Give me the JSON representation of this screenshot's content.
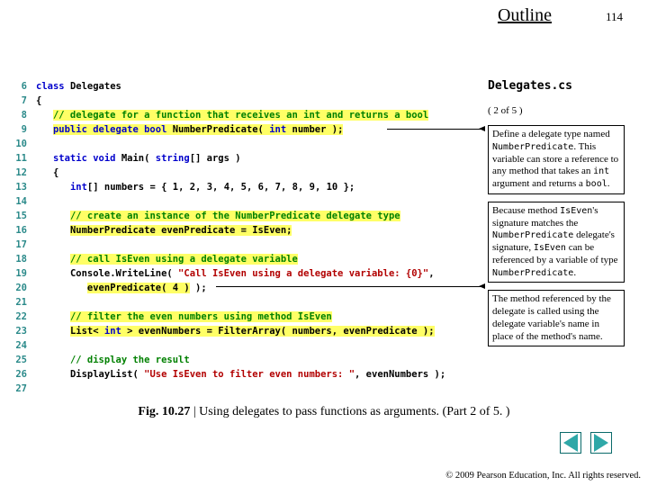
{
  "header": {
    "outline": "Outline",
    "page_number": "114"
  },
  "sidebar": {
    "filename": "Delegates.cs",
    "part": "( 2 of 5 )",
    "callouts": [
      {
        "pre": "Define a delegate type named ",
        "mono1": "NumberPredicate",
        "mid": ". This variable can store a reference to any method that takes an ",
        "mono2": "int",
        "post": " argument and returns a ",
        "mono3": "bool",
        "tail": "."
      },
      {
        "pre": "Because method ",
        "mono1": "IsEven",
        "mid": "'s signature matches the ",
        "mono2": "NumberPredicate",
        "mid2": " delegate's signature, ",
        "mono3": "IsEven",
        "mid3": " can be referenced by a variable of type ",
        "mono4": "NumberPredicate",
        "tail": "."
      },
      {
        "pre": "The method referenced by the delegate is called using the delegate variable's name in place of the method's name.",
        "mono1": "",
        "mid": "",
        "tail": ""
      }
    ]
  },
  "code": [
    {
      "n": "6",
      "seg": [
        [
          "kw",
          "class "
        ],
        [
          "nm",
          "Delegates"
        ]
      ]
    },
    {
      "n": "7",
      "seg": [
        [
          "nm",
          "{"
        ]
      ]
    },
    {
      "n": "8",
      "seg": [
        [
          "sp",
          "   "
        ],
        [
          "hl-cm",
          "// delegate for a function that receives an int and returns a bool"
        ]
      ]
    },
    {
      "n": "9",
      "seg": [
        [
          "sp",
          "   "
        ],
        [
          "hl-kw",
          "public delegate bool"
        ],
        [
          "hl-nm",
          " NumberPredicate( "
        ],
        [
          "hl-kw",
          "int"
        ],
        [
          "hl-nm",
          " number );"
        ]
      ]
    },
    {
      "n": "10",
      "seg": [
        [
          "nm",
          ""
        ]
      ]
    },
    {
      "n": "11",
      "seg": [
        [
          "sp",
          "   "
        ],
        [
          "kw",
          "static void "
        ],
        [
          "nm",
          "Main( "
        ],
        [
          "kw",
          "string"
        ],
        [
          "nm",
          "[] args )"
        ]
      ]
    },
    {
      "n": "12",
      "seg": [
        [
          "sp",
          "   "
        ],
        [
          "nm",
          "{"
        ]
      ]
    },
    {
      "n": "13",
      "seg": [
        [
          "sp",
          "      "
        ],
        [
          "kw",
          "int"
        ],
        [
          "nm",
          "[] numbers = { "
        ],
        [
          "num",
          "1"
        ],
        [
          "nm",
          ", "
        ],
        [
          "num",
          "2"
        ],
        [
          "nm",
          ", "
        ],
        [
          "num",
          "3"
        ],
        [
          "nm",
          ", "
        ],
        [
          "num",
          "4"
        ],
        [
          "nm",
          ", "
        ],
        [
          "num",
          "5"
        ],
        [
          "nm",
          ", "
        ],
        [
          "num",
          "6"
        ],
        [
          "nm",
          ", "
        ],
        [
          "num",
          "7"
        ],
        [
          "nm",
          ", "
        ],
        [
          "num",
          "8"
        ],
        [
          "nm",
          ", "
        ],
        [
          "num",
          "9"
        ],
        [
          "nm",
          ", "
        ],
        [
          "num",
          "10"
        ],
        [
          "nm",
          " };"
        ]
      ]
    },
    {
      "n": "14",
      "seg": [
        [
          "nm",
          ""
        ]
      ]
    },
    {
      "n": "15",
      "seg": [
        [
          "sp",
          "      "
        ],
        [
          "hl-cm",
          "// create an instance of the NumberPredicate delegate type"
        ]
      ]
    },
    {
      "n": "16",
      "seg": [
        [
          "sp",
          "      "
        ],
        [
          "hl-nm",
          "NumberPredicate evenPredicate = IsEven;"
        ]
      ]
    },
    {
      "n": "17",
      "seg": [
        [
          "nm",
          ""
        ]
      ]
    },
    {
      "n": "18",
      "seg": [
        [
          "sp",
          "      "
        ],
        [
          "hl-cm",
          "// call IsEven using a delegate variable"
        ]
      ]
    },
    {
      "n": "19",
      "seg": [
        [
          "sp",
          "      "
        ],
        [
          "nm",
          "Console.WriteLine( "
        ],
        [
          "str",
          "\"Call IsEven using a delegate variable: {0}\""
        ],
        [
          "nm",
          ","
        ]
      ]
    },
    {
      "n": "20",
      "seg": [
        [
          "sp",
          "         "
        ],
        [
          "hl-nm",
          "evenPredicate( "
        ],
        [
          "hl-num",
          "4"
        ],
        [
          "hl-nm",
          " )"
        ],
        [
          "nm",
          " );"
        ]
      ]
    },
    {
      "n": "21",
      "seg": [
        [
          "nm",
          ""
        ]
      ]
    },
    {
      "n": "22",
      "seg": [
        [
          "sp",
          "      "
        ],
        [
          "hl-cm",
          "// filter the even numbers using method IsEven"
        ]
      ]
    },
    {
      "n": "23",
      "seg": [
        [
          "sp",
          "      "
        ],
        [
          "hl-nm",
          "List< "
        ],
        [
          "hl-kw",
          "int"
        ],
        [
          "hl-nm",
          " > evenNumbers = FilterArray( numbers, evenPredicate );"
        ]
      ]
    },
    {
      "n": "24",
      "seg": [
        [
          "nm",
          ""
        ]
      ]
    },
    {
      "n": "25",
      "seg": [
        [
          "sp",
          "      "
        ],
        [
          "cm",
          "// display the result"
        ]
      ]
    },
    {
      "n": "26",
      "seg": [
        [
          "sp",
          "      "
        ],
        [
          "nm",
          "DisplayList( "
        ],
        [
          "str",
          "\"Use IsEven to filter even numbers: \""
        ],
        [
          "nm",
          ", evenNumbers );"
        ]
      ]
    },
    {
      "n": "27",
      "seg": [
        [
          "nm",
          ""
        ]
      ]
    }
  ],
  "caption": {
    "fig": "Fig. 10.27",
    "sep": " | ",
    "text": "Using delegates to pass functions as arguments. (Part 2 of 5. )"
  },
  "copyright": "© 2009 Pearson Education, Inc.  All rights reserved."
}
